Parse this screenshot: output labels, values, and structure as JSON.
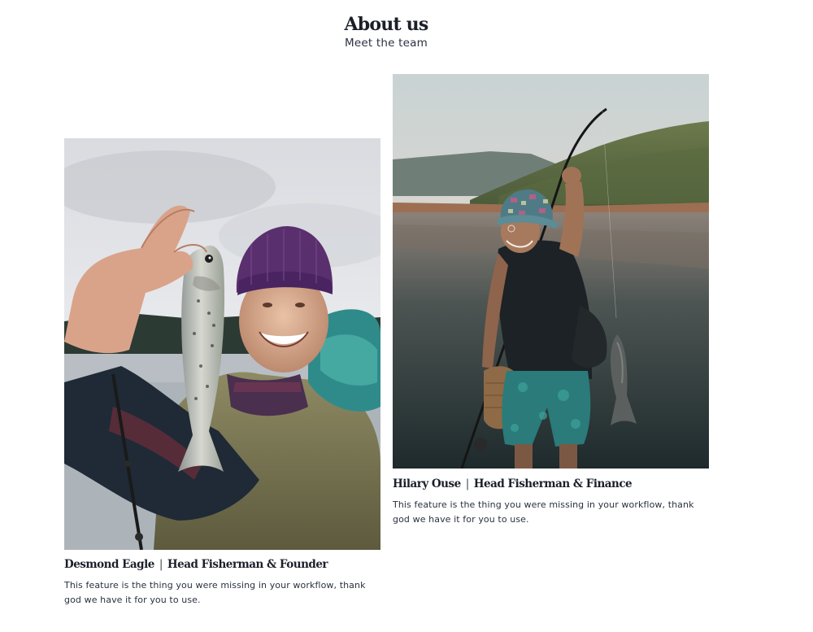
{
  "header": {
    "title": "About us",
    "subtitle": "Meet the team"
  },
  "team": [
    {
      "name": "Desmond Eagle",
      "separator": "|",
      "role": "Head Fisherman & Founder",
      "description": "This feature is the thing you were missing in your workflow, thank god we have it for you to use.",
      "photo_icon": "fisherman-holding-trout-photo"
    },
    {
      "name": "Hilary Ouse",
      "separator": "|",
      "role": "Head Fisherman & Finance",
      "description": "This feature is the thing you were missing in your workflow, thank god we have it for you to use.",
      "photo_icon": "fisherman-at-lake-photo"
    }
  ],
  "colors": {
    "text": "#1a1f29",
    "body_text": "#2b3140",
    "background": "#ffffff"
  }
}
